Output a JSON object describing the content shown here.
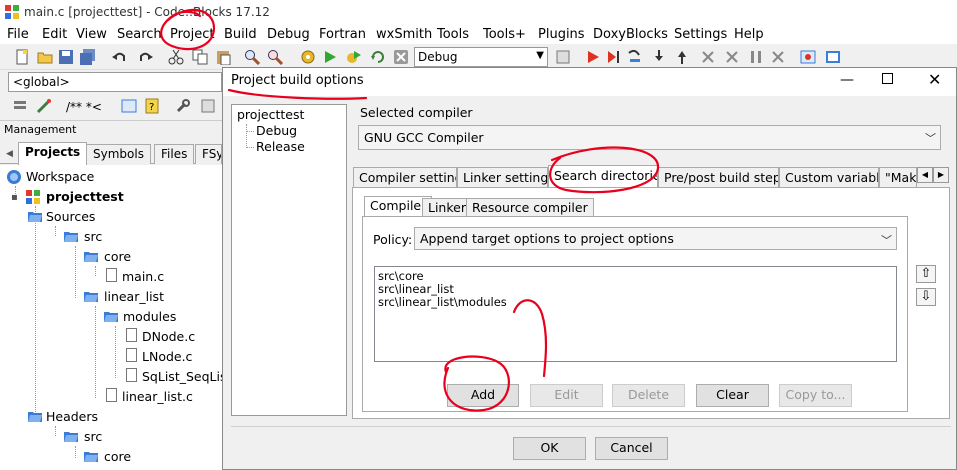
{
  "window": {
    "title": "main.c [projecttest] - Code::Blocks 17.12"
  },
  "menu": [
    "File",
    "Edit",
    "View",
    "Search",
    "Project",
    "Build",
    "Debug",
    "Fortran",
    "wxSmith",
    "Tools",
    "Tools+",
    "Plugins",
    "DoxyBlocks",
    "Settings",
    "Help"
  ],
  "toolbar": {
    "build_target": "Debug",
    "scope": "<global>",
    "doxy_label": "/** *<"
  },
  "management": {
    "title": "Management",
    "tabs": [
      "Projects",
      "Symbols",
      "Files",
      "FSy"
    ],
    "tree": {
      "workspace": "Workspace",
      "project": "projecttest",
      "sources": "Sources",
      "src": "src",
      "core": "core",
      "main_c": "main.c",
      "linear_list": "linear_list",
      "modules": "modules",
      "dnode": "DNode.c",
      "lnode": "LNode.c",
      "sqlist": "SqList_SeqList",
      "linear_list_c": "linear_list.c",
      "headers": "Headers",
      "src2": "src",
      "core2": "core"
    }
  },
  "dialog": {
    "title": "Project build options",
    "targets": [
      "projecttest",
      "Debug",
      "Release"
    ],
    "selected_compiler_label": "Selected compiler",
    "selected_compiler": "GNU GCC Compiler",
    "tabs": [
      "Compiler settings",
      "Linker settings",
      "Search directories",
      "Pre/post build steps",
      "Custom variables",
      "\"Make"
    ],
    "inner_tabs": [
      "Compiler",
      "Linker",
      "Resource compiler"
    ],
    "policy_label": "Policy:",
    "policy_value": "Append target options to project options",
    "directories": [
      "src\\core",
      "src\\linear_list",
      "src\\linear_list\\modules"
    ],
    "buttons": {
      "add": "Add",
      "edit": "Edit",
      "delete": "Delete",
      "clear": "Clear",
      "copy_to": "Copy to...",
      "ok": "OK",
      "cancel": "Cancel"
    }
  },
  "colors": {
    "annotation": "#e8001c",
    "folder": "#3a7bd5",
    "selection": "#cce8ff"
  }
}
